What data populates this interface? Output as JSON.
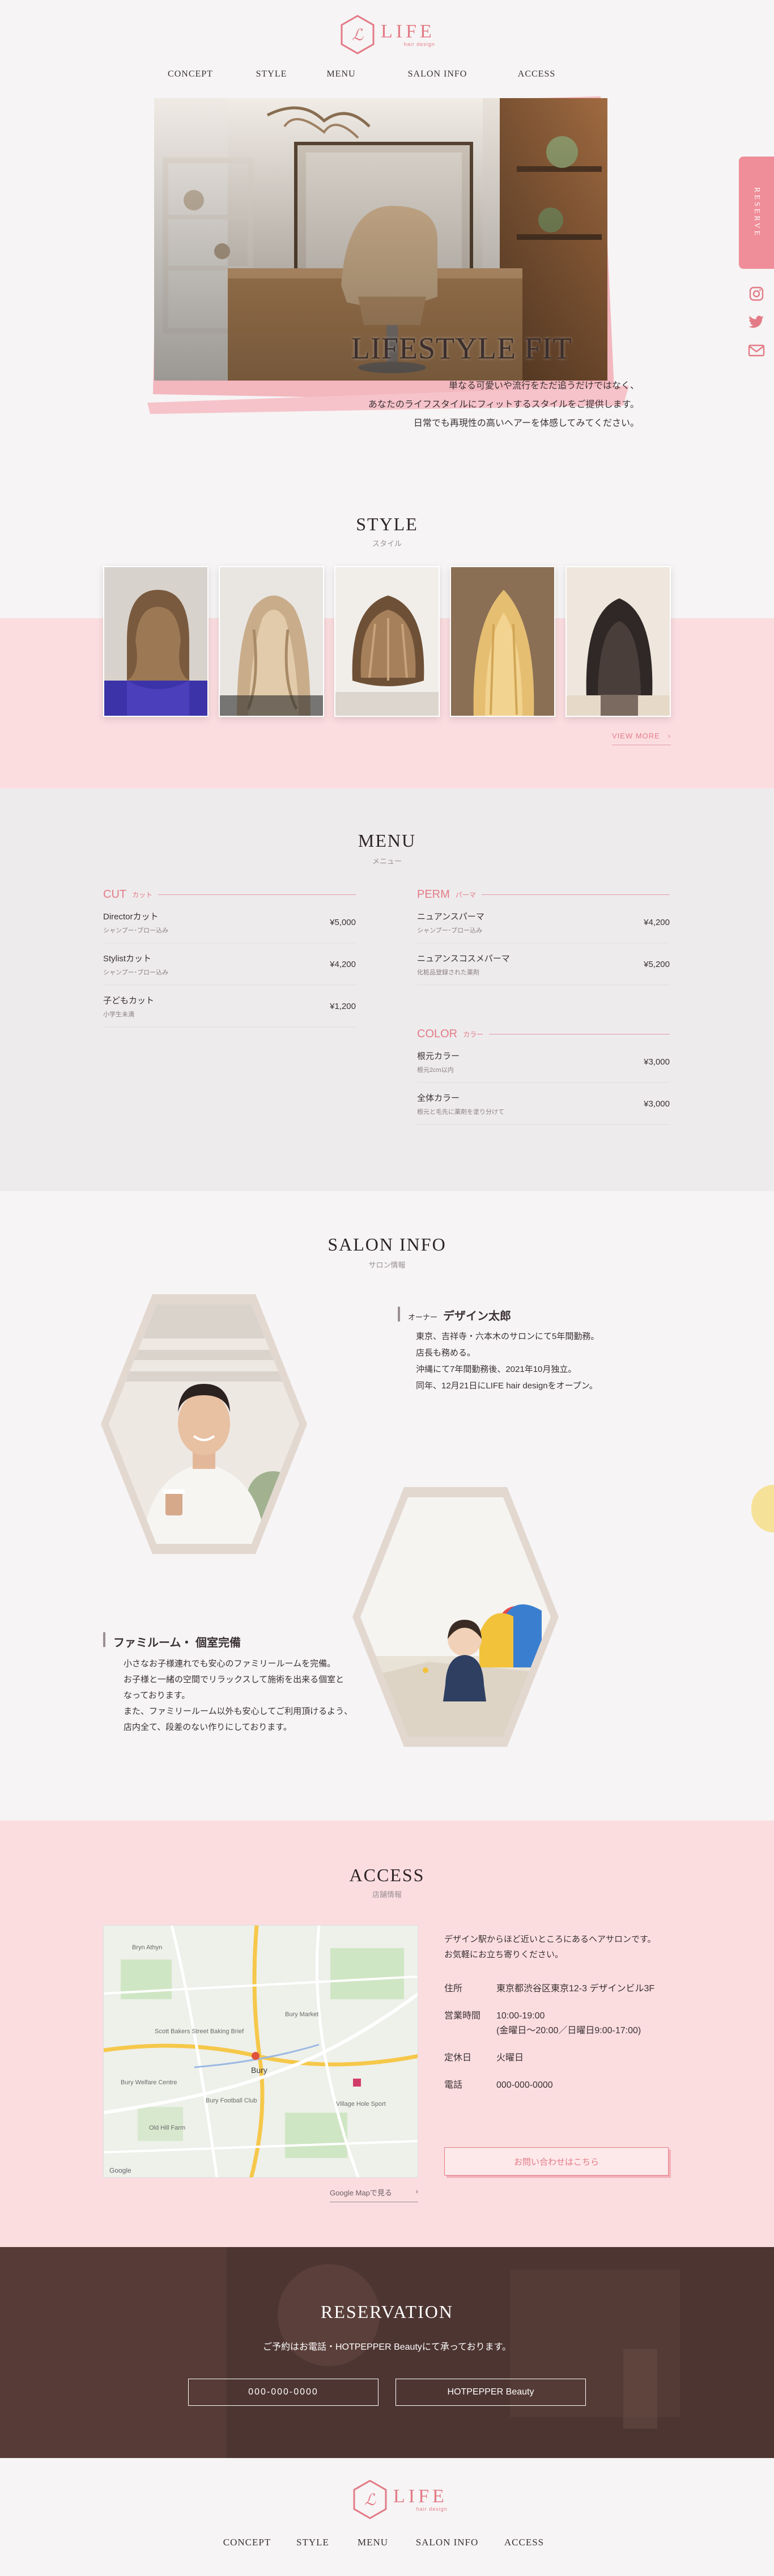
{
  "brand": {
    "name": "LIFE",
    "tagline": "hair design"
  },
  "nav": [
    "CONCEPT",
    "STYLE",
    "MENU",
    "SALON INFO",
    "ACCESS"
  ],
  "side": {
    "reserve": "RESERVE",
    "icons": [
      "instagram-icon",
      "twitter-icon",
      "mail-icon"
    ]
  },
  "hero": {
    "headline": "LIFESTYLE FIT",
    "lines": [
      "単なる可愛いや流行をただ追うだけではなく、",
      "あなたのライフスタイルにフィットするスタイルをご提供します。",
      "日常でも再現性の高いヘアーを体感してみてください。"
    ]
  },
  "style": {
    "title": "STYLE",
    "sub": "スタイル",
    "more": "VIEW MORE"
  },
  "menu": {
    "title": "MENU",
    "sub": "メニュー",
    "cut": {
      "label": "CUT",
      "kana": "カット",
      "items": [
        {
          "name": "Directorカット",
          "note": "シャンプー･ブロー込み",
          "price": "¥5,000"
        },
        {
          "name": "Stylistカット",
          "note": "シャンプー･ブロー込み",
          "price": "¥4,200"
        },
        {
          "name": "子どもカット",
          "note": "小学生未満",
          "price": "¥1,200"
        }
      ]
    },
    "perm": {
      "label": "PERM",
      "kana": "パーマ",
      "items": [
        {
          "name": "ニュアンスパーマ",
          "note": "シャンプー･ブロー込み",
          "price": "¥4,200"
        },
        {
          "name": "ニュアンスコスメパーマ",
          "note": "化粧品登録された薬剤",
          "price": "¥5,200"
        }
      ]
    },
    "color": {
      "label": "COLOR",
      "kana": "カラー",
      "items": [
        {
          "name": "根元カラー",
          "note": "根元2cm以内",
          "price": "¥3,000"
        },
        {
          "name": "全体カラー",
          "note": "根元と毛先に薬剤を塗り分けて",
          "price": "¥3,000"
        }
      ]
    }
  },
  "salon": {
    "title": "SALON INFO",
    "sub": "サロン情報",
    "owner_role": "オーナー",
    "owner_name": "デザイン太郎",
    "owner_lines": [
      "東京、吉祥寺・六本木のサロンにて5年間勤務。",
      "店長も務める。",
      "沖縄にて7年間勤務後、2021年10月独立。",
      "同年、12月21日にLIFE hair designをオープン。"
    ],
    "room_title": "ファミルーム・ 個室完備",
    "room_lines": [
      "小さなお子様連れでも安心のファミリールームを完備。",
      "お子様と一緒の空間でリラックスして施術を出来る個室と",
      "なっております。",
      "また、ファミリールーム以外も安心してご利用頂けるよう、",
      "店内全て、段差のない作りにしております。"
    ]
  },
  "access": {
    "title": "ACCESS",
    "sub": "店舗情報",
    "intro": [
      "デザイン駅からほど近いところにあるヘアサロンです。",
      "お気軽にお立ち寄りください。"
    ],
    "rows": [
      {
        "k": "住所",
        "v": "東京都渋谷区東京12-3 デザインビル3F"
      },
      {
        "k": "営業時間",
        "v": "10:00-19:00",
        "v2": "(金曜日〜20:00／日曜日9:00-17:00)"
      },
      {
        "k": "定休日",
        "v": "火曜日"
      },
      {
        "k": "電話",
        "v": "000-000-0000"
      }
    ],
    "contact": "お問い合わせはこちら",
    "maplink": "Google Mapで見る",
    "map_labels": [
      "Bryn Athyn",
      "Scott Bakers Street Baking Brief",
      "Bury",
      "Bury Market",
      "Bury Welfare Centre",
      "Bury Football Club",
      "Village Hole Sport",
      "Old Hill Farm"
    ],
    "map_footer": "Google"
  },
  "reservation": {
    "title": "RESERVATION",
    "text": "ご予約はお電話・HOTPEPPER Beautyにて承っております。",
    "phone": "000-000-0000",
    "hp": "HOTPEPPER Beauty"
  },
  "colors": {
    "accent": "#e37b86",
    "pink_bg": "#fbdde0",
    "gray_bg": "#eeebed"
  }
}
